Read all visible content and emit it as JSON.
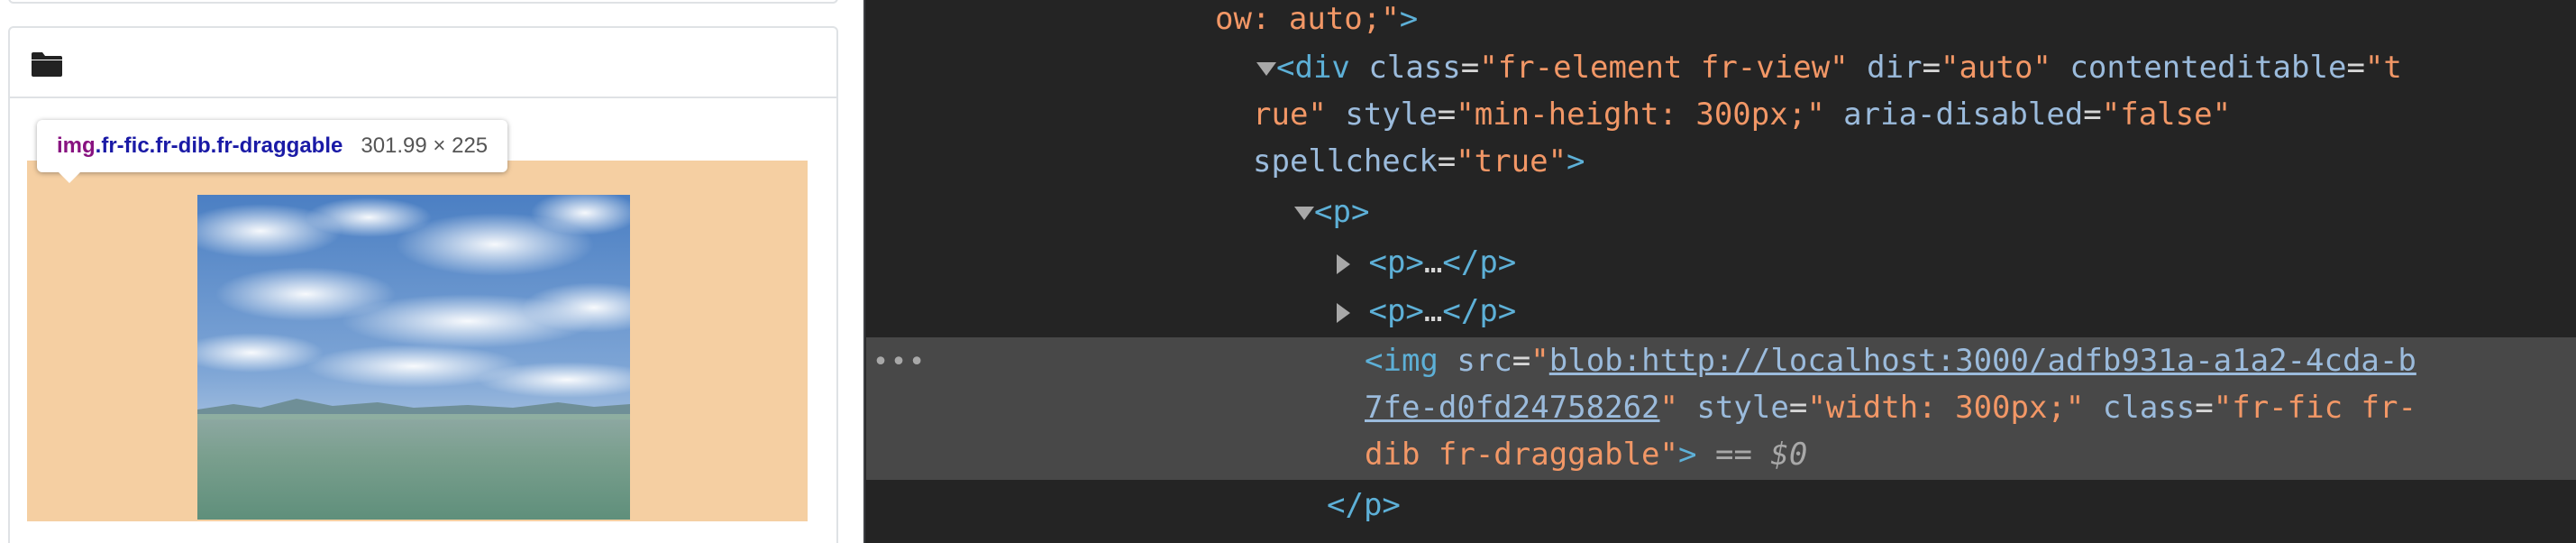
{
  "tooltip": {
    "tag": "img",
    "classes": ".fr-fic.fr-dib.fr-draggable",
    "dims": "301.99 × 225"
  },
  "editor": {
    "folder_icon": "folder-icon",
    "image": "landscape-photo"
  },
  "devtools": {
    "line1": {
      "val": "ow: auto;",
      "tagclose": ">"
    },
    "line2": {
      "open": "<div",
      "a1": "class",
      "v1": "fr-element fr-view",
      "a2": "dir",
      "v2": "auto",
      "a3": "contenteditable",
      "v3a": "t"
    },
    "line3": {
      "v3b": "rue",
      "a4": "style",
      "v4": "min-height: 300px;",
      "a5": "aria-disabled",
      "v5": "false"
    },
    "line4": {
      "a6": "spellcheck",
      "v6": "true",
      "close": ">"
    },
    "line5": {
      "tag": "<p>"
    },
    "line6": {
      "open": "<p>",
      "ell": "…",
      "close": "</p>"
    },
    "line7": {
      "open": "<p>",
      "ell": "…",
      "close": "</p>"
    },
    "line8": {
      "open": "<img",
      "a1": "src",
      "url1": "blob:http://localhost:3000/adfb931a-a1a2-4cda-b"
    },
    "line9": {
      "url2": "7fe-d0fd24758262",
      "a2": "style",
      "v2": "width: 300px;",
      "a3": "class",
      "v3a": "fr-fic fr-"
    },
    "line10": {
      "v3b": "dib fr-draggable",
      "close": ">",
      "eqeq": "==",
      "dollar": "$0"
    },
    "line11": {
      "tag": "</p>"
    },
    "dots": "•••"
  },
  "colors": {
    "devtools_bg": "#242424",
    "selected_row": "#484848",
    "tag": "#5db0d7",
    "attr_name": "#9bbbdc",
    "attr_value": "#f29766",
    "image_padding": "#f5cfa2"
  }
}
